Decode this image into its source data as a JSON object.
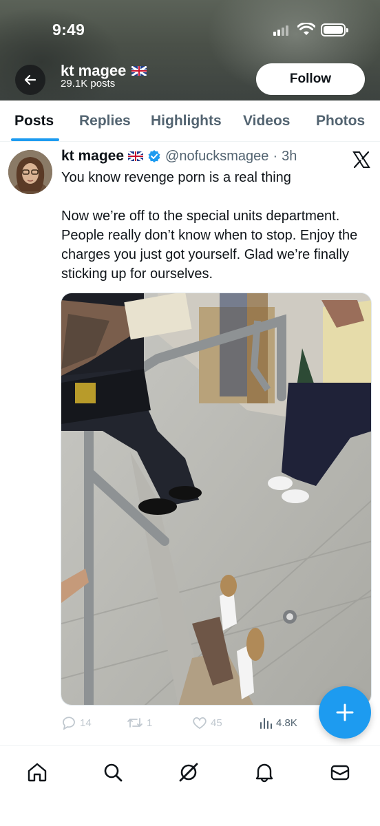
{
  "status_bar": {
    "time": "9:49",
    "icons": [
      "cellular-signal-icon",
      "wifi-icon",
      "battery-icon"
    ]
  },
  "profile": {
    "name": "kt magee",
    "flag_icon": "uk-flag-icon",
    "posts_count": "29.1K posts",
    "follow_label": "Follow",
    "back_icon": "arrow-left-icon"
  },
  "tabs": [
    {
      "label": "Posts",
      "active": true
    },
    {
      "label": "Replies",
      "active": false
    },
    {
      "label": "Highlights",
      "active": false
    },
    {
      "label": "Videos",
      "active": false
    },
    {
      "label": "Photos",
      "active": false
    }
  ],
  "tweet": {
    "author_name": "kt magee",
    "verified": true,
    "handle": "@nofucksmagee",
    "separator": "·",
    "time": "3h",
    "text_line1": "You know revenge porn is a real thing",
    "text_paragraph2": "Now we’re off to the special units department. People really don’t know when to stop. Enjoy the charges you just got yourself. Glad we’re finally sticking up for ourselves.",
    "metrics": {
      "replies": "14",
      "reposts": "1",
      "likes": "45",
      "views": "4.8K"
    }
  },
  "colors": {
    "accent": "#1d9bf0",
    "text": "#0f1419",
    "muted": "#536471"
  },
  "bottom_nav": [
    "home-icon",
    "search-icon",
    "grok-icon",
    "notifications-icon",
    "messages-icon"
  ],
  "compose_icon": "plus-icon"
}
